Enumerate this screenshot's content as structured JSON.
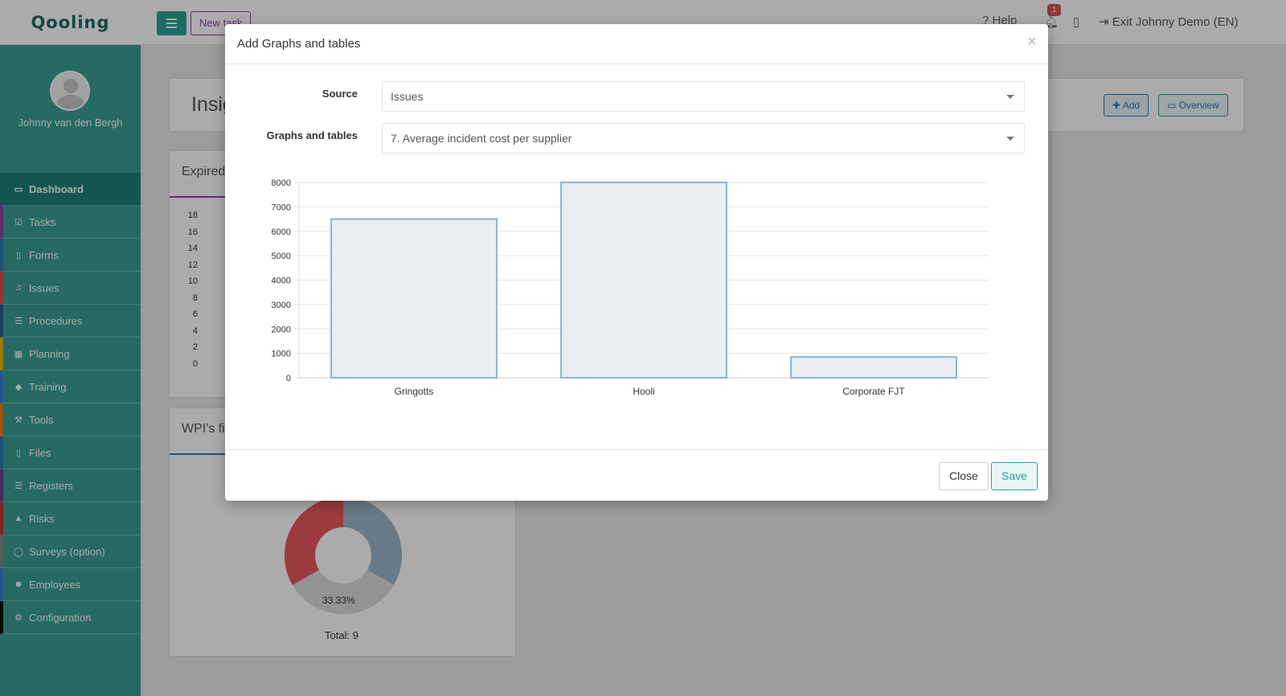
{
  "app": {
    "logo": "Qooling",
    "new_task_label": "New task",
    "help_label": "Help",
    "notification_count": "1",
    "exit_label": "Exit Johnny Demo (EN)"
  },
  "user": {
    "name": "Johnny van den Bergh"
  },
  "sidebar": {
    "items": [
      {
        "label": "Dashboard",
        "icon": "monitor-icon",
        "accent": "#1e8177"
      },
      {
        "label": "Tasks",
        "icon": "check-square-icon",
        "accent": "#8e44ad"
      },
      {
        "label": "Forms",
        "icon": "file-icon",
        "accent": "#2b7bb9"
      },
      {
        "label": "Issues",
        "icon": "bell-icon",
        "accent": "#d9534f"
      },
      {
        "label": "Procedures",
        "icon": "list-icon",
        "accent": "#2b5797"
      },
      {
        "label": "Planning",
        "icon": "calendar-icon",
        "accent": "#e6b800"
      },
      {
        "label": "Training",
        "icon": "graduation-cap-icon",
        "accent": "#3b7dd8"
      },
      {
        "label": "Tools",
        "icon": "wrench-icon",
        "accent": "#e67e22"
      },
      {
        "label": "Files",
        "icon": "file-icon",
        "accent": "#2b7bb9"
      },
      {
        "label": "Registers",
        "icon": "list-icon",
        "accent": "#6a3d9a"
      },
      {
        "label": "Risks",
        "icon": "warning-icon",
        "accent": "#c0392b"
      },
      {
        "label": "Surveys (option)",
        "icon": "comment-icon",
        "accent": "#7f8c8d"
      },
      {
        "label": "Employees",
        "icon": "users-icon",
        "accent": "#3b7dd8"
      },
      {
        "label": "Configuration",
        "icon": "gear-icon",
        "accent": "#111111"
      }
    ]
  },
  "background": {
    "insights_title": "Insig",
    "add_label": "Add",
    "overview_label": "Overview",
    "expired_title": "Expired",
    "expired_yticks": [
      "18",
      "16",
      "14",
      "12",
      "10",
      "8",
      "6",
      "4",
      "2",
      "0"
    ],
    "wpi_title": "WPI's fil",
    "donut_label": "33.33%",
    "donut_total": "Total: 9"
  },
  "modal": {
    "title": "Add Graphs and tables",
    "close_x": "×",
    "source_label": "Source",
    "source_value": "Issues",
    "graph_label": "Graphs and tables",
    "graph_value": "7. Average incident cost per supplier",
    "close_button": "Close",
    "save_button": "Save"
  },
  "chart_data": {
    "type": "bar",
    "categories": [
      "Gringotts",
      "Hooli",
      "Corporate FJT"
    ],
    "values": [
      6500,
      8000,
      850
    ],
    "yticks": [
      0,
      1000,
      2000,
      3000,
      4000,
      5000,
      6000,
      7000,
      8000
    ],
    "ylim": [
      0,
      8000
    ],
    "grid": true,
    "bar_fill": "#e8eef2",
    "bar_stroke": "#8fb3cc"
  }
}
